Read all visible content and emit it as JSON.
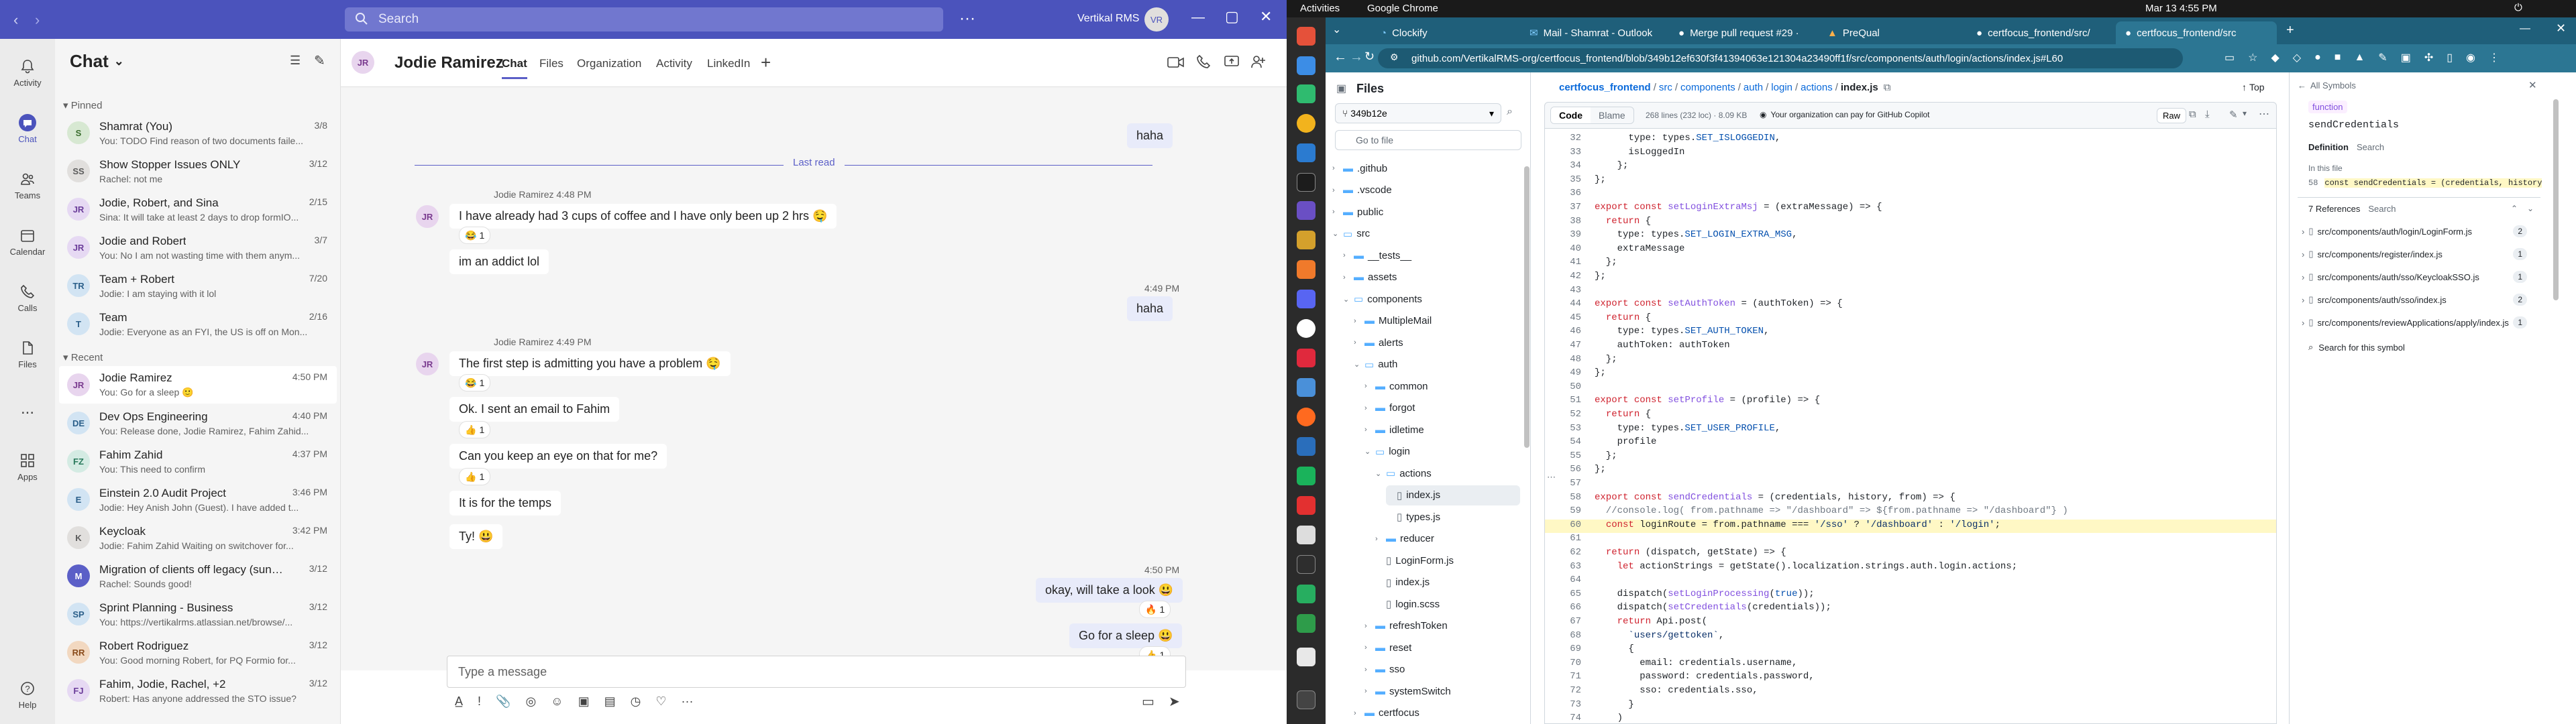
{
  "teams": {
    "title_bar": {
      "search_placeholder": "Search",
      "org": "Vertikal RMS",
      "org_avatar": "VR"
    },
    "rail": [
      {
        "label": "Activity",
        "icon": "bell-icon"
      },
      {
        "label": "Chat",
        "icon": "chat-icon",
        "active": true
      },
      {
        "label": "Teams",
        "icon": "teams-icon"
      },
      {
        "label": "Calendar",
        "icon": "calendar-icon"
      },
      {
        "label": "Calls",
        "icon": "phone-icon"
      },
      {
        "label": "Files",
        "icon": "file-icon"
      },
      {
        "label": "...",
        "icon": "more-icon"
      },
      {
        "label": "Apps",
        "icon": "apps-icon"
      },
      {
        "label": "Help",
        "icon": "help-icon"
      }
    ],
    "list": {
      "header": "Chat",
      "pinned_label": "Pinned",
      "recent_label": "Recent",
      "pinned": [
        {
          "initials": "S",
          "bg": "#d7e8d2",
          "fg": "#3a6e2e",
          "name": "Shamrat (You)",
          "time": "3/8",
          "preview": "You: TODO Find reason of two documents faile..."
        },
        {
          "initials": "SS",
          "bg": "#e1dfdd",
          "fg": "#5c5c5c",
          "name": "Show Stopper Issues ONLY",
          "time": "3/12",
          "preview": "Rachel: not me"
        },
        {
          "initials": "JR",
          "bg": "#e6d9f3",
          "fg": "#6b3d9a",
          "name": "Jodie, Robert, and Sina",
          "time": "2/15",
          "preview": "Sina: It will take at least 2 days to drop formIO..."
        },
        {
          "initials": "JR",
          "bg": "#e6d9f3",
          "fg": "#6b3d9a",
          "name": "Jodie and Robert",
          "time": "3/7",
          "preview": "You: No I am not wasting time with them anym..."
        },
        {
          "initials": "TR",
          "bg": "#d2e4f3",
          "fg": "#2b5f8a",
          "name": "Team + Robert",
          "time": "7/20",
          "preview": "Jodie: I am staying with it lol"
        },
        {
          "initials": "T",
          "bg": "#d2e4f3",
          "fg": "#2b5f8a",
          "name": "Team",
          "time": "2/16",
          "preview": "Jodie: Everyone as an FYI, the US is off on Mon..."
        }
      ],
      "recent": [
        {
          "initials": "JR",
          "bg": "#e8d5ee",
          "fg": "#7a3b8f",
          "name": "Jodie Ramirez",
          "time": "4:50 PM",
          "preview": "You: Go for a sleep 🙂",
          "selected": true
        },
        {
          "initials": "DE",
          "bg": "#d2e4f3",
          "fg": "#2b5f8a",
          "name": "Dev Ops Engineering",
          "time": "4:40 PM",
          "preview": "You: Release done, Jodie Ramirez, Fahim Zahid..."
        },
        {
          "initials": "FZ",
          "bg": "#d4ebe3",
          "fg": "#2a7a5c",
          "name": "Fahim Zahid",
          "time": "4:37 PM",
          "preview": "You: This need to confirm"
        },
        {
          "initials": "E",
          "bg": "#d2e4f3",
          "fg": "#2b5f8a",
          "name": "Einstein 2.0 Audit Project",
          "time": "3:46 PM",
          "preview": "Jodie: Hey Anish John (Guest). I have added t..."
        },
        {
          "initials": "K",
          "bg": "#e1dfdd",
          "fg": "#5c5c5c",
          "name": "Keycloak",
          "time": "3:42 PM",
          "preview": "Jodie: Fahim Zahid Waiting on switchover for..."
        },
        {
          "initials": "M",
          "bg": "#5b5fc7",
          "fg": "#ffffff",
          "name": "Migration of clients off legacy (sunse...",
          "time": "3/12",
          "preview": "Rachel: Sounds good!"
        },
        {
          "initials": "SP",
          "bg": "#d2e4f3",
          "fg": "#2b5f8a",
          "name": "Sprint Planning - Business",
          "time": "3/12",
          "preview": "You: https://vertikalrms.atlassian.net/browse/..."
        },
        {
          "initials": "RR",
          "bg": "#f2d8c0",
          "fg": "#8a4b1a",
          "name": "Robert Rodriguez",
          "time": "3/12",
          "preview": "You: Good morning Robert, for PQ Formio for..."
        },
        {
          "initials": "FJ",
          "bg": "#e6d9f3",
          "fg": "#6b3d9a",
          "name": "Fahim, Jodie, Rachel, +2",
          "time": "3/12",
          "preview": "Robert: Has anyone addressed the STO issue?"
        }
      ]
    },
    "chat": {
      "contact_initials": "JR",
      "contact_name": "Jodie Ramirez",
      "tabs": [
        "Chat",
        "Files",
        "Organization",
        "Activity",
        "LinkedIn"
      ],
      "last_read": "Last read",
      "compose_placeholder": "Type a message",
      "messages": {
        "m0": "haha",
        "g1_meta": "Jodie Ramirez   4:48 PM",
        "m1": "I have already had 3 cups of coffee and I have only been up 2 hrs 🤤",
        "m1_react": "1",
        "m2": "im an addict lol",
        "m3_time": "4:49 PM",
        "m3": "haha",
        "g2_meta": "Jodie Ramirez   4:49 PM",
        "m4": "The first step is admitting you have a problem 🤤",
        "m4_react": "1",
        "m5": "Ok. I sent an email to Fahim",
        "m5_react": "1",
        "m6": "Can you keep an eye on that for me?",
        "m6_react": "1",
        "m7": "It is for the temps",
        "m8": "Ty! 😃",
        "m9_time": "4:50 PM",
        "m9": "okay, will take a look 😃",
        "m9_react": "1",
        "m10": "Go for a sleep 😃",
        "m10_react": "1"
      }
    }
  },
  "gnome": {
    "activities": "Activities",
    "app": "Google Chrome",
    "datetime": "Mar 13  4:55 PM"
  },
  "chrome": {
    "tabs": [
      "Clockify",
      "Mail - Shamrat - Outlook",
      "Merge pull request #29 ·",
      "PreQual",
      "certfocus_frontend/src/",
      "certfocus_frontend/src"
    ],
    "url": "github.com/VertikalRMS-org/certfocus_frontend/blob/349b12ef630f3f41394063e121304a23490ff1f/src/components/auth/login/actions/index.js#L60"
  },
  "github": {
    "files_title": "Files",
    "branch": "349b12e",
    "go_to_file": "Go to file",
    "breadcrumb": [
      "certfocus_frontend",
      "src",
      "components",
      "auth",
      "login",
      "actions",
      "index.js"
    ],
    "top_label": "Top",
    "view_tabs": [
      "Code",
      "Blame"
    ],
    "file_info": "268 lines (232 loc) · 8.09 KB",
    "copilot_note": "Your organization can pay for GitHub Copilot",
    "raw_label": "Raw",
    "tree": [
      {
        "name": ".github",
        "depth": 0,
        "type": "dir"
      },
      {
        "name": ".vscode",
        "depth": 0,
        "type": "dir"
      },
      {
        "name": "public",
        "depth": 0,
        "type": "dir"
      },
      {
        "name": "src",
        "depth": 0,
        "type": "dir-open"
      },
      {
        "name": "__tests__",
        "depth": 1,
        "type": "dir"
      },
      {
        "name": "assets",
        "depth": 1,
        "type": "dir"
      },
      {
        "name": "components",
        "depth": 1,
        "type": "dir-open"
      },
      {
        "name": "MultipleMail",
        "depth": 2,
        "type": "dir"
      },
      {
        "name": "alerts",
        "depth": 2,
        "type": "dir"
      },
      {
        "name": "auth",
        "depth": 2,
        "type": "dir-open"
      },
      {
        "name": "common",
        "depth": 3,
        "type": "dir"
      },
      {
        "name": "forgot",
        "depth": 3,
        "type": "dir"
      },
      {
        "name": "idletime",
        "depth": 3,
        "type": "dir"
      },
      {
        "name": "login",
        "depth": 3,
        "type": "dir-open"
      },
      {
        "name": "actions",
        "depth": 4,
        "type": "dir-open"
      },
      {
        "name": "index.js",
        "depth": 5,
        "type": "file",
        "selected": true
      },
      {
        "name": "types.js",
        "depth": 5,
        "type": "file"
      },
      {
        "name": "reducer",
        "depth": 4,
        "type": "dir"
      },
      {
        "name": "LoginForm.js",
        "depth": 4,
        "type": "file"
      },
      {
        "name": "index.js",
        "depth": 4,
        "type": "file"
      },
      {
        "name": "login.scss",
        "depth": 4,
        "type": "file"
      },
      {
        "name": "refreshToken",
        "depth": 3,
        "type": "dir"
      },
      {
        "name": "reset",
        "depth": 3,
        "type": "dir"
      },
      {
        "name": "sso",
        "depth": 3,
        "type": "dir"
      },
      {
        "name": "systemSwitch",
        "depth": 3,
        "type": "dir"
      },
      {
        "name": "certfocus",
        "depth": 2,
        "type": "dir"
      }
    ],
    "code": [
      {
        "n": "32",
        "t": "      type: types.SET_ISLOGGEDIN,"
      },
      {
        "n": "33",
        "t": "      isLoggedIn"
      },
      {
        "n": "34",
        "t": "    };"
      },
      {
        "n": "35",
        "t": "};"
      },
      {
        "n": "36",
        "t": ""
      },
      {
        "n": "37",
        "t": "export const setLoginExtraMsj = (extraMessage) => {"
      },
      {
        "n": "38",
        "t": "  return {"
      },
      {
        "n": "39",
        "t": "    type: types.SET_LOGIN_EXTRA_MSG,"
      },
      {
        "n": "40",
        "t": "    extraMessage"
      },
      {
        "n": "41",
        "t": "  };"
      },
      {
        "n": "42",
        "t": "};"
      },
      {
        "n": "43",
        "t": ""
      },
      {
        "n": "44",
        "t": "export const setAuthToken = (authToken) => {"
      },
      {
        "n": "45",
        "t": "  return {"
      },
      {
        "n": "46",
        "t": "    type: types.SET_AUTH_TOKEN,"
      },
      {
        "n": "47",
        "t": "    authToken: authToken"
      },
      {
        "n": "48",
        "t": "  };"
      },
      {
        "n": "49",
        "t": "};"
      },
      {
        "n": "50",
        "t": ""
      },
      {
        "n": "51",
        "t": "export const setProfile = (profile) => {"
      },
      {
        "n": "52",
        "t": "  return {"
      },
      {
        "n": "53",
        "t": "    type: types.SET_USER_PROFILE,"
      },
      {
        "n": "54",
        "t": "    profile"
      },
      {
        "n": "55",
        "t": "  };"
      },
      {
        "n": "56",
        "t": "};"
      },
      {
        "n": "57",
        "t": ""
      },
      {
        "n": "58",
        "t": "export const sendCredentials = (credentials, history, from) => {"
      },
      {
        "n": "59",
        "t": "  //console.log( from.pathname => \"/dashboard\" => ${from.pathname => \"/dashboard\"} )"
      },
      {
        "n": "60",
        "t": "  const loginRoute = from.pathname === '/sso' ? '/dashboard' : '/login';",
        "hl": true
      },
      {
        "n": "61",
        "t": ""
      },
      {
        "n": "62",
        "t": "  return (dispatch, getState) => {"
      },
      {
        "n": "63",
        "t": "    let actionStrings = getState().localization.strings.auth.login.actions;"
      },
      {
        "n": "64",
        "t": ""
      },
      {
        "n": "65",
        "t": "    dispatch(setLoginProcessing(true));"
      },
      {
        "n": "66",
        "t": "    dispatch(setCredentials(credentials));"
      },
      {
        "n": "67",
        "t": "    return Api.post("
      },
      {
        "n": "68",
        "t": "      `users/gettoken`,"
      },
      {
        "n": "69",
        "t": "      {"
      },
      {
        "n": "70",
        "t": "        email: credentials.username,"
      },
      {
        "n": "71",
        "t": "        password: credentials.password,"
      },
      {
        "n": "72",
        "t": "        sso: credentials.sso,"
      },
      {
        "n": "73",
        "t": "      }"
      },
      {
        "n": "74",
        "t": "    )"
      }
    ],
    "symbols": {
      "header": "All Symbols",
      "kind": "function",
      "name": "sendCredentials",
      "def_tabs": [
        "Definition",
        "Search"
      ],
      "in_this_file": "In this file",
      "def_line_no": "58",
      "def_line": "const sendCredentials = (credentials, history",
      "refs_title": "7 References",
      "refs_search": "Search",
      "refs": [
        {
          "path": "src/components/auth/login/LoginForm.js",
          "count": "2"
        },
        {
          "path": "src/components/register/index.js",
          "count": "1"
        },
        {
          "path": "src/components/auth/sso/KeycloakSSO.js",
          "count": "1"
        },
        {
          "path": "src/components/auth/sso/index.js",
          "count": "2"
        },
        {
          "path": "src/components/reviewApplications/apply/index.js",
          "count": "1"
        }
      ],
      "search_symbol": "Search for this symbol"
    }
  }
}
